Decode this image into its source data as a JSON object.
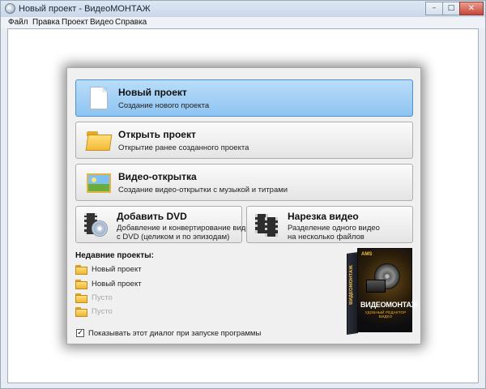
{
  "window": {
    "title": "Новый проект - ВидеоМОНТАЖ"
  },
  "window_controls": {
    "minimize": "–",
    "maximize": "□",
    "close": "✕"
  },
  "menu": [
    "Файл",
    "Правка",
    "Проект",
    "Видео",
    "Справка"
  ],
  "actions": {
    "new_project": {
      "title": "Новый проект",
      "subtitle": "Создание нового проекта",
      "icon": "new-document-icon"
    },
    "open_project": {
      "title": "Открыть проект",
      "subtitle": "Открытие ранее созданного проекта",
      "icon": "folder-icon"
    },
    "video_card": {
      "title": "Видео-открытка",
      "subtitle": "Создание видео-открытки с музыкой и титрами",
      "icon": "postcard-icon"
    },
    "add_dvd": {
      "title": "Добавить DVD",
      "subtitle_line1": "Добавление и конвертирование видео",
      "subtitle_line2": "с DVD (целиком и по эпизодам)",
      "icon": "dvd-icon"
    },
    "cut_video": {
      "title": "Нарезка видео",
      "subtitle_line1": "Разделение одного видео",
      "subtitle_line2": "на несколько файлов",
      "icon": "film-strip-icon"
    }
  },
  "recent": {
    "title": "Недавние проекты:",
    "items": [
      {
        "label": "Новый проект",
        "empty": false
      },
      {
        "label": "Новый проект",
        "empty": false
      },
      {
        "label": "Пусто",
        "empty": true
      },
      {
        "label": "Пусто",
        "empty": true
      }
    ]
  },
  "startup_checkbox": {
    "label": "Показывать этот диалог при запуске программы",
    "checked": true,
    "mark": "✓"
  },
  "product_box": {
    "brand": "AMS",
    "name": "ВИДЕОМОНТАЖ",
    "tagline": "УДОБНЫЙ РЕДАКТОР ВИДЕО",
    "side_text": "ВИДЕОМОНТАЖ"
  },
  "colors": {
    "selected_button": "#8ec4f1",
    "dialog_background": "#f0f0f0"
  }
}
